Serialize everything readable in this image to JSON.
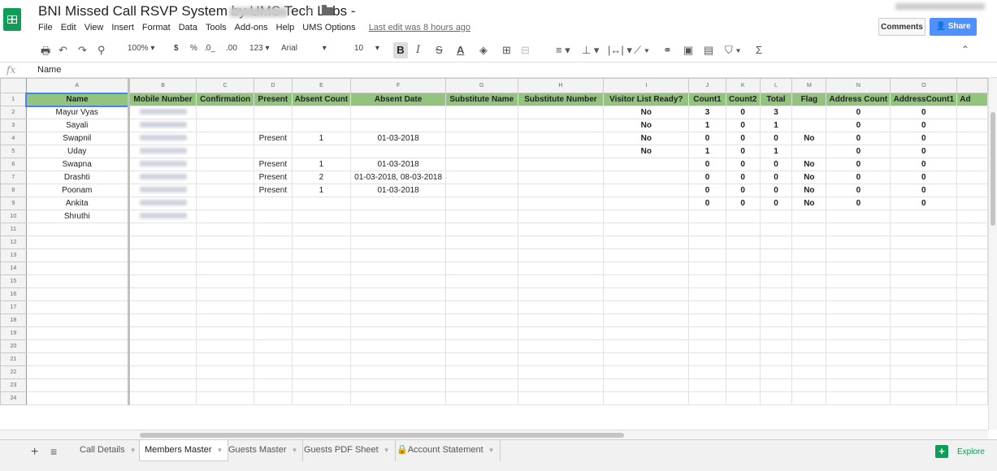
{
  "title": {
    "doc_title": "BNI Missed Call RSVP System by UMS Tech Labs -",
    "last_edit": "Last edit was 8 hours ago"
  },
  "menu": [
    "File",
    "Edit",
    "View",
    "Insert",
    "Format",
    "Data",
    "Tools",
    "Add-ons",
    "Help",
    "UMS Options"
  ],
  "buttons": {
    "comments": "Comments",
    "share": "Share"
  },
  "toolbar": {
    "zoom": "100%",
    "currency": "$",
    "percent": "%",
    "dec_less": ".0_",
    "dec_more": ".00",
    "number_format": "123",
    "font": "Arial",
    "font_size": "10",
    "bold": "B",
    "italic": "I",
    "strike": "S",
    "text_color": "A",
    "sum": "Σ"
  },
  "formula": {
    "fx": "fx",
    "value": "Name"
  },
  "columns": [
    "A",
    "B",
    "C",
    "D",
    "E",
    "F",
    "G",
    "H",
    "I",
    "J",
    "K",
    "L",
    "M",
    "N",
    "O"
  ],
  "headers": [
    "Name",
    "Mobile Number",
    "Confirmation",
    "Present",
    "Absent Count",
    "Absent Date",
    "Substitute Name",
    "Substitute Number",
    "Visitor List Ready?",
    "Count1",
    "Count2",
    "Total",
    "Flag",
    "Address Count",
    "AddressCount1",
    "Ad"
  ],
  "rows": [
    {
      "name": "Mayur Vyas",
      "present": "",
      "absent_count": "",
      "absent_date": "",
      "visitor": "No",
      "count1": "3",
      "count2": "0",
      "total": "3",
      "flag": "",
      "addr": "0",
      "addr1": "0"
    },
    {
      "name": "Sayali",
      "present": "",
      "absent_count": "",
      "absent_date": "",
      "visitor": "No",
      "count1": "1",
      "count2": "0",
      "total": "1",
      "flag": "",
      "addr": "0",
      "addr1": "0"
    },
    {
      "name": "Swapnil",
      "present": "Present",
      "absent_count": "1",
      "absent_date": "01-03-2018",
      "visitor": "No",
      "count1": "0",
      "count2": "0",
      "total": "0",
      "flag": "No",
      "addr": "0",
      "addr1": "0"
    },
    {
      "name": "Uday",
      "present": "",
      "absent_count": "",
      "absent_date": "",
      "visitor": "No",
      "count1": "1",
      "count2": "0",
      "total": "1",
      "flag": "",
      "addr": "0",
      "addr1": "0"
    },
    {
      "name": "Swapna",
      "present": "Present",
      "absent_count": "1",
      "absent_date": "01-03-2018",
      "visitor": "",
      "count1": "0",
      "count2": "0",
      "total": "0",
      "flag": "No",
      "addr": "0",
      "addr1": "0"
    },
    {
      "name": "Drashti",
      "present": "Present",
      "absent_count": "2",
      "absent_date": "01-03-2018, 08-03-2018",
      "visitor": "",
      "count1": "0",
      "count2": "0",
      "total": "0",
      "flag": "No",
      "addr": "0",
      "addr1": "0"
    },
    {
      "name": "Poonam",
      "present": "Present",
      "absent_count": "1",
      "absent_date": "01-03-2018",
      "visitor": "",
      "count1": "0",
      "count2": "0",
      "total": "0",
      "flag": "No",
      "addr": "0",
      "addr1": "0"
    },
    {
      "name": "Ankita",
      "present": "",
      "absent_count": "",
      "absent_date": "",
      "visitor": "",
      "count1": "0",
      "count2": "0",
      "total": "0",
      "flag": "No",
      "addr": "0",
      "addr1": "0"
    },
    {
      "name": "Shruthi",
      "present": "",
      "absent_count": "",
      "absent_date": "",
      "visitor": "",
      "count1": "",
      "count2": "",
      "total": "",
      "flag": "",
      "addr": "",
      "addr1": ""
    }
  ],
  "row_numbers": [
    "1",
    "2",
    "3",
    "4",
    "5",
    "6",
    "7",
    "8",
    "9",
    "10",
    "11",
    "12",
    "13",
    "14",
    "15",
    "16",
    "17",
    "18",
    "19",
    "20",
    "21",
    "22",
    "23",
    "24"
  ],
  "sheets": [
    "Call Details",
    "Members Master",
    "Guests Master",
    "Guests PDF Sheet",
    "Account Statement"
  ],
  "explore": "Explore",
  "colors": {
    "header_green": "#93c47d",
    "share_blue": "#4d90fe",
    "sheets_green": "#0f9d58"
  }
}
